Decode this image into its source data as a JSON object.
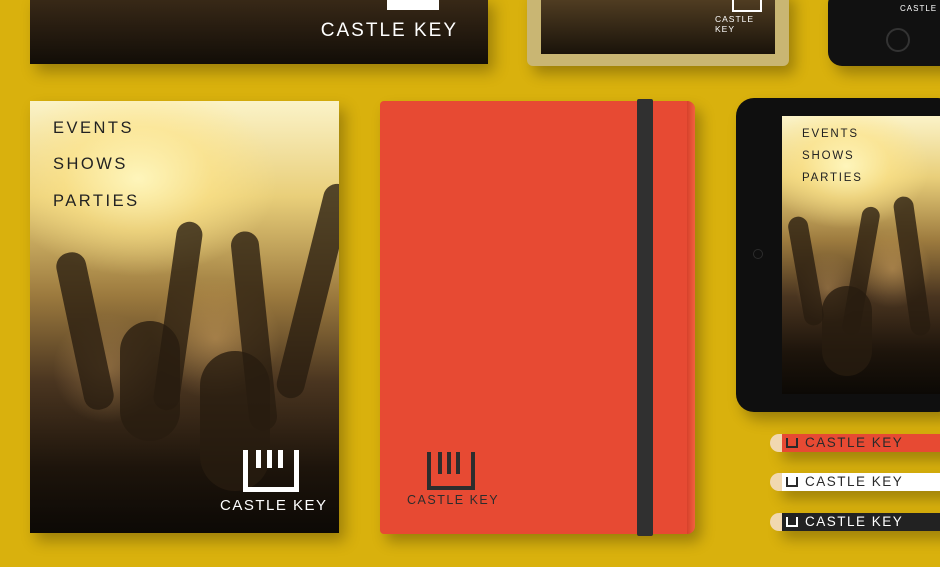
{
  "brand": {
    "name": "CASTLE KEY"
  },
  "poster": {
    "lines": [
      "EVENTS",
      "SHOWS",
      "PARTIES"
    ],
    "brand": "CASTLE KEY"
  },
  "tablet": {
    "lines": [
      "EVENTS",
      "SHOWS",
      "PARTIES"
    ]
  },
  "top_card": {
    "title": "CASTLE KEY"
  },
  "tablet_top": {
    "label": "CASTLE KEY"
  },
  "phone_top": {
    "label": "CASTLE K"
  },
  "notebook": {
    "brand": "CASTLE KEY",
    "color": "#e74a33",
    "elastic_color": "#303030"
  },
  "pencils": [
    {
      "label": "CASTLE KEY",
      "color": "#e74a33"
    },
    {
      "label": "CASTLE KEY",
      "color": "#ffffff"
    },
    {
      "label": "CASTLE KEY",
      "color": "#222222"
    }
  ],
  "background_color": "#d9b10d"
}
